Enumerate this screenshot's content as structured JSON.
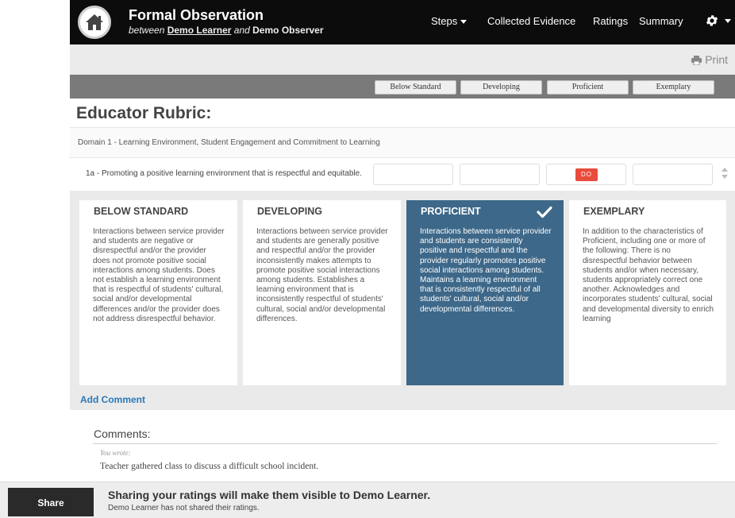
{
  "header": {
    "title": "Formal Observation",
    "subtitle_between": "between",
    "learner": "Demo Learner",
    "subtitle_and": "and",
    "observer": "Demo Observer",
    "nav": {
      "steps": "Steps",
      "evidence": "Collected Evidence",
      "ratings": "Ratings",
      "summary": "Summary"
    },
    "icons": {
      "home": "home-icon",
      "settings": "gear-icon"
    }
  },
  "toolbar": {
    "print": "Print"
  },
  "levels": [
    "Below Standard",
    "Developing",
    "Proficient",
    "Exemplary"
  ],
  "rubric": {
    "title": "Educator Rubric:",
    "domain": "Domain 1 - Learning Environment, Student Engagement and  Commitment to Learning",
    "indicator": "1a - Promoting a positive learning environment that is respectful and equitable.",
    "rating_badge": "DO",
    "selected_level": "Proficient",
    "cards": [
      {
        "title": "BELOW STANDARD",
        "body": "Interactions between service provider and students are negative or disrespectful and/or the provider does not promote positive social interactions among students. Does not establish a learning environment that is respectful of students' cultural, social and/or developmental differences and/or the provider does not address disrespectful behavior."
      },
      {
        "title": "DEVELOPING",
        "body": "Interactions between service provider and students are generally positive and respectful and/or the provider inconsistently makes attempts to promote positive social interactions among students. Establishes a learning environment that is inconsistently respectful of students' cultural, social and/or developmental differences."
      },
      {
        "title": "PROFICIENT",
        "body": "Interactions between service provider and students are consistently positive and respectful and the provider regularly promotes positive social interactions among students. Maintains a learning environment that is consistently respectful of all students' cultural, social and/or developmental differences."
      },
      {
        "title": "EXEMPLARY",
        "body": "In addition to the characteristics of Proficient, including one or more of the following: There is no disrespectful behavior between students and/or when necessary, students appropriately correct one another. Acknowledges and incorporates students' cultural, social and developmental diversity to enrich learning"
      }
    ],
    "add_comment": "Add Comment"
  },
  "comments": {
    "title": "Comments:",
    "author_label": "You wrote:",
    "text": "Teacher gathered class to discuss a difficult school incident."
  },
  "footer": {
    "share_button": "Share",
    "message": "Sharing your ratings will make them visible to Demo Learner.",
    "status": "Demo Learner has not shared their ratings."
  },
  "colors": {
    "header_bg": "#0c0c0c",
    "selected_card": "#3d6889",
    "link": "#2b78b8",
    "badge": "#e94b3c"
  }
}
